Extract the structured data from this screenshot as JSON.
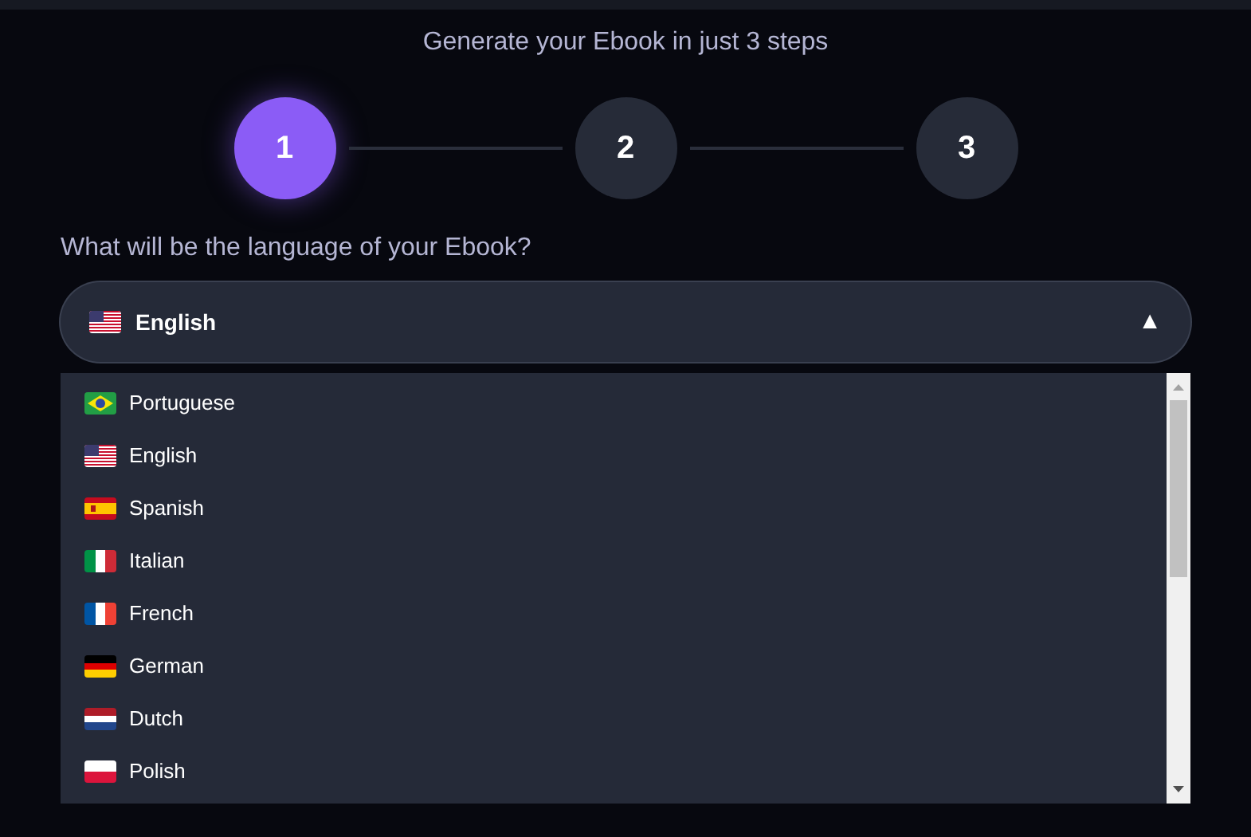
{
  "heading": "Generate your Ebook in just 3 steps",
  "steps": [
    {
      "label": "1",
      "selected": true
    },
    {
      "label": "2",
      "selected": false
    },
    {
      "label": "3",
      "selected": false
    }
  ],
  "question": "What will be the language of your Ebook?",
  "select": {
    "value": "English",
    "kind": "us",
    "expanded": true,
    "toggle": "▲"
  },
  "options": [
    {
      "label": "Portuguese",
      "kind": "br"
    },
    {
      "label": "English",
      "kind": "us"
    },
    {
      "label": "Spanish",
      "kind": "es"
    },
    {
      "label": "Italian",
      "kind": "it"
    },
    {
      "label": "French",
      "kind": "fr"
    },
    {
      "label": "German",
      "kind": "de"
    },
    {
      "label": "Dutch",
      "kind": "nl"
    },
    {
      "label": "Polish",
      "kind": "pl"
    }
  ]
}
